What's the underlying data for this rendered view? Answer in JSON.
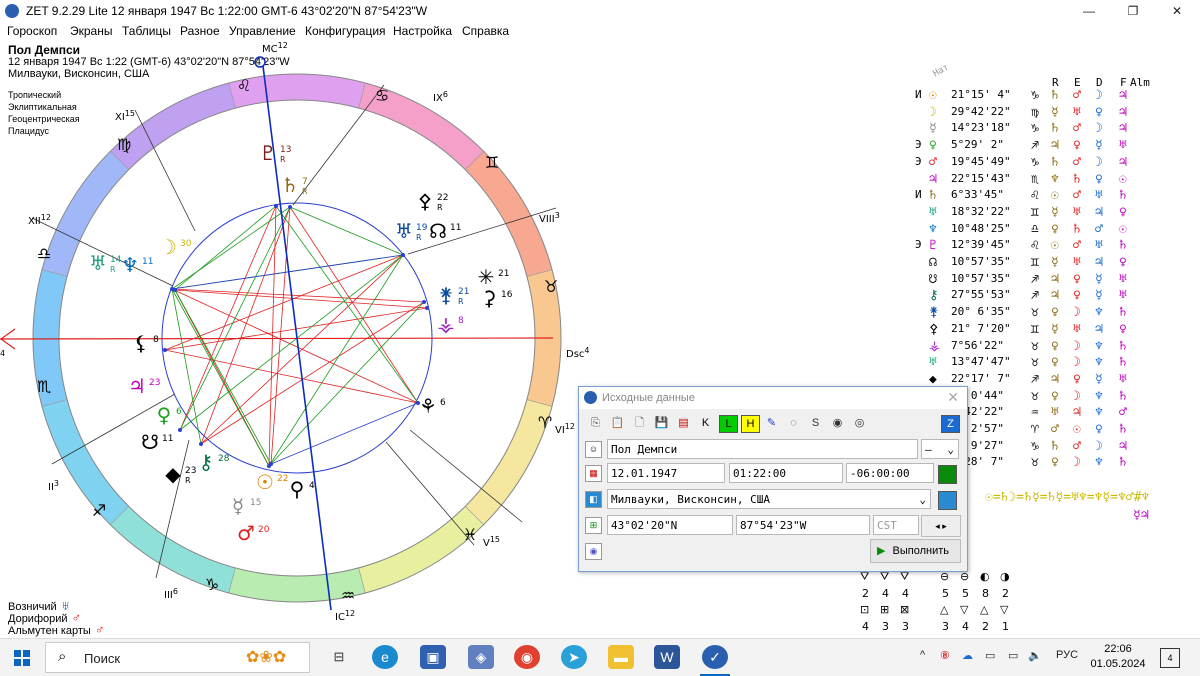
{
  "window": {
    "title": "ZET 9.2.29 Lite   12 января 1947  Вс   1:22:00 GMT-6 43°02'20\"N  87°54'23\"W",
    "minimize": "—",
    "restore": "❐",
    "close": "✕"
  },
  "menu": [
    "Гороскоп",
    "Экраны",
    "Таблицы",
    "Разное",
    "Управление",
    "Конфигурация",
    "Настройка",
    "Справка"
  ],
  "chart_info": {
    "name": "Пол Демпси",
    "line1": "12 января 1947  Вс   1:22 (GMT-6) 43°02'20\"N 87°54'23\"W",
    "line2": "Милвауки, Висконсин, США"
  },
  "settings": [
    "Тропический",
    "Эклиптикальная",
    "Геоцентрическая",
    "Плацидус"
  ],
  "houses": {
    "mc": "MC",
    "mc_num": "12",
    "ic": "IC",
    "ic_num": "12",
    "ix": "IX",
    "ix_num": "6",
    "viii": "VIII",
    "viii_num": "3",
    "xi": "XI",
    "xi_num": "15",
    "xii": "XII",
    "xii_num": "12",
    "dsc": "Dsc",
    "dsc_num": "4",
    "asc_num": "4",
    "vi": "VI",
    "vi_num": "12",
    "v": "V",
    "v_num": "15",
    "iii": "III",
    "iii_num": "6",
    "ii": "II",
    "ii_num": "3"
  },
  "wheel_planets": [
    {
      "glyph": "♇",
      "deg": "13",
      "retro": "R",
      "color": "#7a1a1a"
    },
    {
      "glyph": "♄",
      "deg": "7",
      "retro": "R",
      "color": "#8a6a10"
    },
    {
      "glyph": "☽",
      "deg": "30",
      "retro": "",
      "color": "#c8b800"
    },
    {
      "glyph": "♅",
      "deg": "14",
      "retro": "R",
      "color": "#1aa080"
    },
    {
      "glyph": "♆",
      "deg": "11",
      "retro": "",
      "color": "#0070c0"
    },
    {
      "glyph": "⚴",
      "deg": "22",
      "retro": "R",
      "color": "#000"
    },
    {
      "glyph": "♅",
      "deg": "19",
      "retro": "R",
      "color": "#0b4aa0"
    },
    {
      "glyph": "☊",
      "deg": "11",
      "retro": "",
      "color": "#000"
    },
    {
      "glyph": "⚵",
      "deg": "21",
      "retro": "R",
      "color": "#0b4aa0"
    },
    {
      "glyph": "⚳",
      "deg": "16",
      "retro": "",
      "color": "#000"
    },
    {
      "glyph": "✳",
      "deg": "21",
      "retro": "",
      "color": "#000"
    },
    {
      "glyph": "⚶",
      "deg": "8",
      "retro": "",
      "color": "#a020c0"
    },
    {
      "glyph": "⚸",
      "deg": "8",
      "retro": "",
      "color": "#000"
    },
    {
      "glyph": "♃",
      "deg": "23",
      "retro": "",
      "color": "#c000c0"
    },
    {
      "glyph": "♀",
      "deg": "6",
      "retro": "",
      "color": "#20a020"
    },
    {
      "glyph": "☋",
      "deg": "11",
      "retro": "",
      "color": "#000"
    },
    {
      "glyph": "⚷",
      "deg": "28",
      "retro": "",
      "color": "#007040"
    },
    {
      "glyph": "◆",
      "deg": "23",
      "retro": "R",
      "color": "#000"
    },
    {
      "glyph": "☉",
      "deg": "22",
      "retro": "",
      "color": "#e08000"
    },
    {
      "glyph": "⚲",
      "deg": "4",
      "retro": "",
      "color": "#000"
    },
    {
      "glyph": "☿",
      "deg": "15",
      "retro": "",
      "color": "#888"
    },
    {
      "glyph": "♂",
      "deg": "20",
      "retro": "",
      "color": "#e02020"
    },
    {
      "glyph": "⚘",
      "deg": "6",
      "retro": "",
      "color": "#000"
    }
  ],
  "bottom_info": [
    {
      "label": "Возничий",
      "glyph": "♅",
      "color": "#0b4aa0"
    },
    {
      "label": "Дорифорий",
      "glyph": "♂",
      "color": "#e02020"
    },
    {
      "label": "Альмутен карты",
      "glyph": "♂",
      "color": "#e02020"
    }
  ],
  "table": {
    "nat_label": "Нат",
    "headers": [
      "R",
      "E",
      "D",
      "F",
      "Alm"
    ],
    "rows": [
      {
        "pre": "И",
        "planet": "☉",
        "pcolor": "#e08000",
        "pos": "21°15' 4\"",
        "sign": "♑",
        "r": "♄",
        "e": "♂",
        "d": "☽",
        "f": "♃"
      },
      {
        "pre": "",
        "planet": "☽",
        "pcolor": "#c8b800",
        "pos": "29°42'22\"",
        "sign": "♍",
        "r": "☿",
        "e": "♅",
        "d": "♀",
        "f": "♃"
      },
      {
        "pre": "",
        "planet": "☿",
        "pcolor": "#888",
        "pos": "14°23'18\"",
        "sign": "♑",
        "r": "♄",
        "e": "♂",
        "d": "☽",
        "f": "♃"
      },
      {
        "pre": "Э",
        "planet": "♀",
        "pcolor": "#20a020",
        "pos": " 5°29' 2\"",
        "sign": "♐",
        "r": "♃",
        "e": "♀",
        "d": "☿",
        "f": "♅"
      },
      {
        "pre": "Э",
        "planet": "♂",
        "pcolor": "#e02020",
        "pos": "19°45'49\"",
        "sign": "♑",
        "r": "♄",
        "e": "♂",
        "d": "☽",
        "f": "♃"
      },
      {
        "pre": "",
        "planet": "♃",
        "pcolor": "#c000c0",
        "pos": "22°15'43\"",
        "sign": "♏",
        "r": "♆",
        "e": "♄",
        "d": "♀",
        "f": "☉"
      },
      {
        "pre": "И",
        "planet": "♄",
        "pcolor": "#8a6a10",
        "pos": " 6°33'45\"",
        "sign": "♌",
        "r": "☉",
        "e": "♂",
        "d": "♅",
        "f": "♄"
      },
      {
        "pre": "",
        "planet": "♅",
        "pcolor": "#1aa080",
        "pos": "18°32'22\"",
        "sign": "♊",
        "r": "☿",
        "e": "♅",
        "d": "♃",
        "f": "♀"
      },
      {
        "pre": "",
        "planet": "♆",
        "pcolor": "#0070c0",
        "pos": "10°48'25\"",
        "sign": "♎",
        "r": "♀",
        "e": "♄",
        "d": "♂",
        "f": "☉"
      },
      {
        "pre": "Э",
        "planet": "♇",
        "pcolor": "#c000c0",
        "pos": "12°39'45\"",
        "sign": "♌",
        "r": "☉",
        "e": "♂",
        "d": "♅",
        "f": "♄"
      },
      {
        "pre": "",
        "planet": "☊",
        "pcolor": "#000",
        "pos": "10°57'35\"",
        "sign": "♊",
        "r": "☿",
        "e": "♅",
        "d": "♃",
        "f": "♀"
      },
      {
        "pre": "",
        "planet": "☋",
        "pcolor": "#000",
        "pos": "10°57'35\"",
        "sign": "♐",
        "r": "♃",
        "e": "♀",
        "d": "☿",
        "f": "♅"
      },
      {
        "pre": "",
        "planet": "⚷",
        "pcolor": "#007040",
        "pos": "27°55'53\"",
        "sign": "♐",
        "r": "♃",
        "e": "♀",
        "d": "☿",
        "f": "♅"
      },
      {
        "pre": "",
        "planet": "⚵",
        "pcolor": "#0b4aa0",
        "pos": "20° 6'35\"",
        "sign": "♉",
        "r": "♀",
        "e": "☽",
        "d": "♆",
        "f": "♄"
      },
      {
        "pre": "",
        "planet": "⚴",
        "pcolor": "#000",
        "pos": "21° 7'20\"",
        "sign": "♊",
        "r": "☿",
        "e": "♅",
        "d": "♃",
        "f": "♀"
      },
      {
        "pre": "",
        "planet": "⚶",
        "pcolor": "#a020c0",
        "pos": " 7°56'22\"",
        "sign": "♉",
        "r": "♀",
        "e": "☽",
        "d": "♆",
        "f": "♄"
      },
      {
        "pre": "",
        "planet": "♅",
        "pcolor": "#1aa080",
        "pos": "13°47'47\"",
        "sign": "♉",
        "r": "♀",
        "e": "☽",
        "d": "♆",
        "f": "♄"
      },
      {
        "pre": "",
        "planet": "◆",
        "pcolor": "#000",
        "pos": "22°17' 7\"",
        "sign": "♐",
        "r": "♃",
        "e": "♀",
        "d": "☿",
        "f": "♅"
      },
      {
        "pre": "",
        "planet": "",
        "pcolor": "#000",
        "pos": "5° 0'44\"",
        "sign": "♉",
        "r": "♀",
        "e": "☽",
        "d": "♆",
        "f": "♄"
      },
      {
        "pre": "",
        "planet": "",
        "pcolor": "#000",
        "pos": "8°42'22\"",
        "sign": "♒",
        "r": "♅",
        "e": "♃",
        "d": "♆",
        "f": "♂"
      },
      {
        "pre": "",
        "planet": "",
        "pcolor": "#000",
        "pos": "5° 2'57\"",
        "sign": "♈",
        "r": "♂",
        "e": "☉",
        "d": "♀",
        "f": "♄"
      },
      {
        "pre": "",
        "planet": "",
        "pcolor": "#000",
        "pos": "7° 9'27\"",
        "sign": "♑",
        "r": "♄",
        "e": "♂",
        "d": "☽",
        "f": "♃"
      },
      {
        "pre": "",
        "planet": "",
        "pcolor": "#000",
        "pos": "0°28' 7\"",
        "sign": "♉",
        "r": "♀",
        "e": "☽",
        "d": "♆",
        "f": "♄"
      }
    ],
    "formula": "☉=♄☽=♄☿=♄☿=♅♆=♆☿=♆♂#♆",
    "formula2": "☿♃"
  },
  "dialog": {
    "title": "Исходные данные",
    "close": "✕",
    "toolbar": [
      "⎘",
      "📋",
      "🗋",
      "💾",
      "▤",
      "K",
      "L",
      "H",
      "✎",
      "◌",
      "S",
      "◉",
      "◎",
      "Z"
    ],
    "name": "Пол Демпси",
    "gender": "—",
    "date": "12.01.1947",
    "time": "01:22:00",
    "offset": "-06:00:00",
    "place": "Милвауки, Висконсин, США",
    "lat": "43°02'20\"N",
    "lon": "87°54'23\"W",
    "tz": "CST",
    "execute": "Выполнить"
  },
  "aspect_grid": {
    "row1_icons": [
      "⛛",
      "⛛",
      "⛛",
      "⊖",
      "⊖",
      "◐",
      "◑"
    ],
    "row1_nums": [
      "2",
      "4",
      "4",
      "5",
      "5",
      "8",
      "2"
    ],
    "row2_icons": [
      "⊡",
      "⊞",
      "⊠",
      "△",
      "▽",
      "△",
      "▽"
    ],
    "row2_nums": [
      "4",
      "3",
      "3",
      "3",
      "4",
      "2",
      "1"
    ]
  },
  "taskbar": {
    "search": "Поиск",
    "tray_chevron": "^",
    "lang": "РУС",
    "time": "22:06",
    "date": "01.05.2024",
    "notif": "4"
  },
  "colors": {
    "zodiac_ring": [
      "#7fd3f0",
      "#8fe0d8",
      "#b8ecb0",
      "#e8f0a0",
      "#f5e6a0",
      "#f8c890",
      "#f8a890",
      "#f4a0c8",
      "#e0a0f0",
      "#c0a0f0",
      "#a0b8f8",
      "#80c8f8"
    ],
    "red": "#e02020",
    "green": "#1a9a1a",
    "blue_axis": "#0b2ec0"
  }
}
